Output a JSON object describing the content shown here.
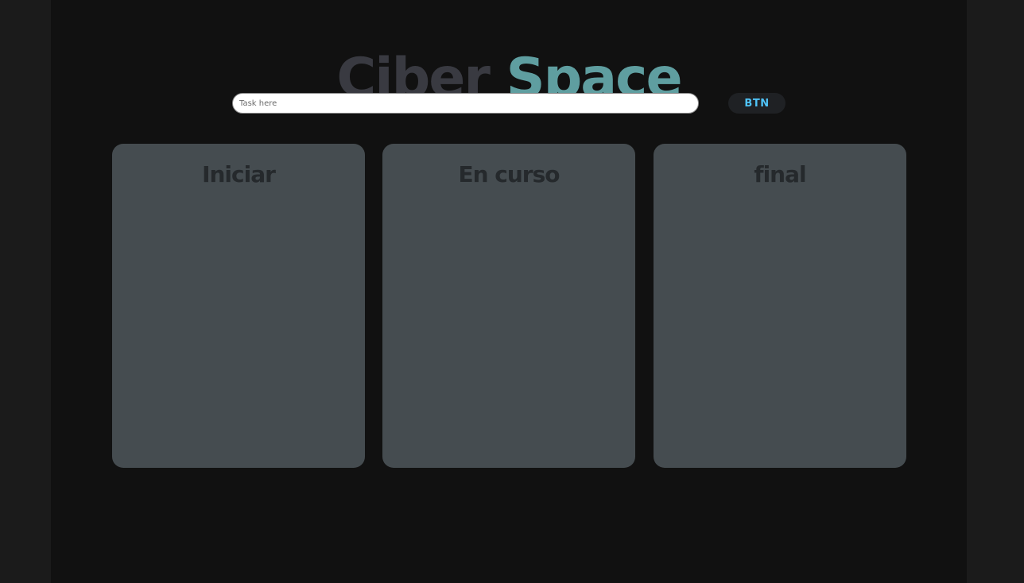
{
  "header": {
    "logo_word1": "Ciber",
    "logo_word2": "Space"
  },
  "task_form": {
    "placeholder": "Task here",
    "value": "",
    "button_label": "BTN"
  },
  "columns": [
    {
      "title": "Iniciar"
    },
    {
      "title": "En curso"
    },
    {
      "title": "final"
    }
  ],
  "colors": {
    "page_background": "#111111",
    "outer_background": "#1b1b1b",
    "logo_word1": "#393a41",
    "logo_word2": "#5f9ea0",
    "column_background": "#454c50",
    "column_title": "#25292c",
    "button_text": "#4fc3f7"
  }
}
